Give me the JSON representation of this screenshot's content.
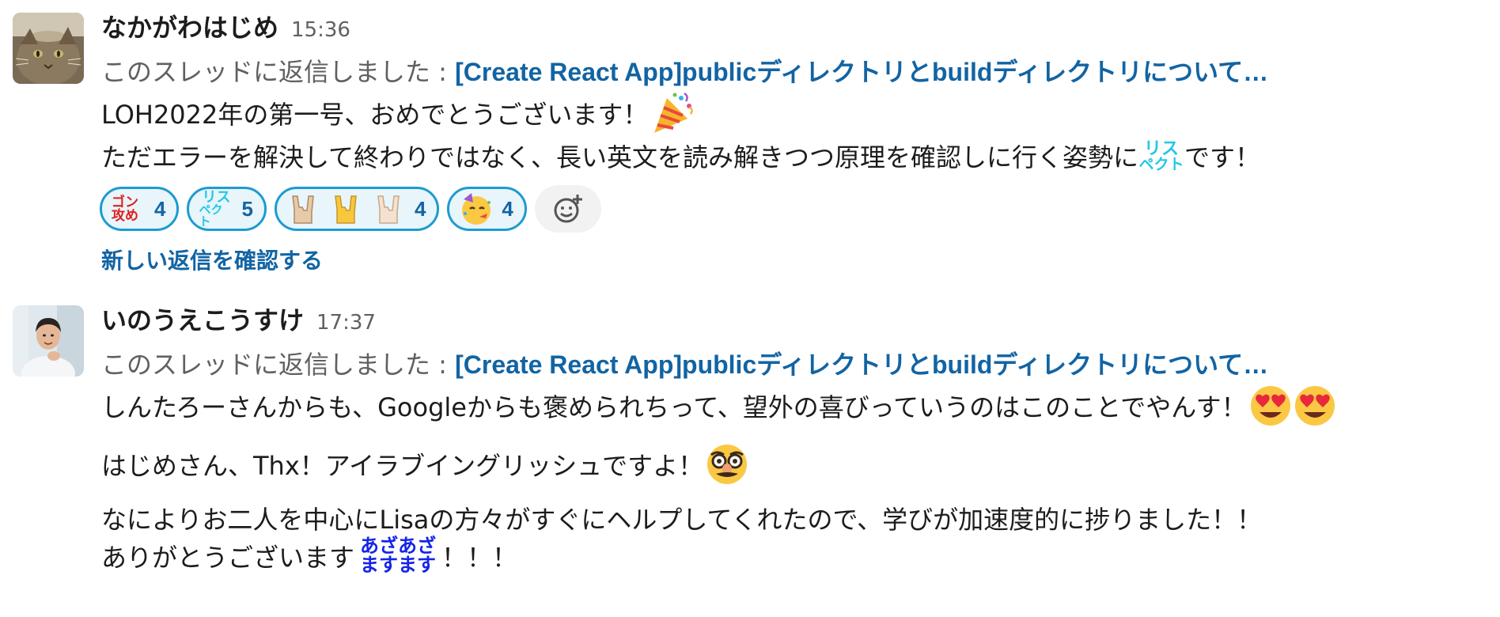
{
  "messages": [
    {
      "author": "なかがわはじめ",
      "time": "15:36",
      "thread_prefix": "このスレッドに返信しました : ",
      "thread_title": "[Create React App]publicディレクトリとbuildディレクトリについて…",
      "lines": [
        "LOH2022年の第一号、おめでとうございます！",
        "ただエラーを解決して終わりではなく、長い英文を読み解きつつ原理を確認しに行く姿勢に",
        "です！"
      ],
      "inline_emoji": {
        "respect_top": "リス",
        "respect_bottom": "ペクト"
      },
      "reactions": [
        {
          "emoji": "gon-zeme",
          "label": "ゴン攻め",
          "count": "4"
        },
        {
          "emoji": "respect",
          "label_top": "リス",
          "label_bottom": "ペクト",
          "count": "5"
        },
        {
          "emoji": "sign-of-the-horns",
          "count": "4"
        },
        {
          "emoji": "partying-face",
          "count": "4"
        }
      ],
      "new_replies_link": "新しい返信を確認する"
    },
    {
      "author": "いのうえこうすけ",
      "time": "17:37",
      "thread_prefix": "このスレッドに返信しました : ",
      "thread_title": "[Create React App]publicディレクトリとbuildディレクトリについて…",
      "lines": [
        "しんたろーさんからも、Googleからも褒められちって、望外の喜びっていうのはこのことでやんす！",
        "はじめさん、Thx！アイラブイングリッシュですよ！",
        "なによりお二人を中心にLisaの方々がすぐにヘルプしてくれたので、学びが加速度的に捗りました！！",
        "ありがとうございます",
        "！！！"
      ],
      "inline_emoji": {
        "azas_top": "あざあざ",
        "azas_bottom": "ますます"
      }
    }
  ],
  "colors": {
    "link": "#1264a3",
    "reaction_border": "#1d9bd1",
    "reaction_bg": "#e8f5fa",
    "muted": "#616061"
  }
}
